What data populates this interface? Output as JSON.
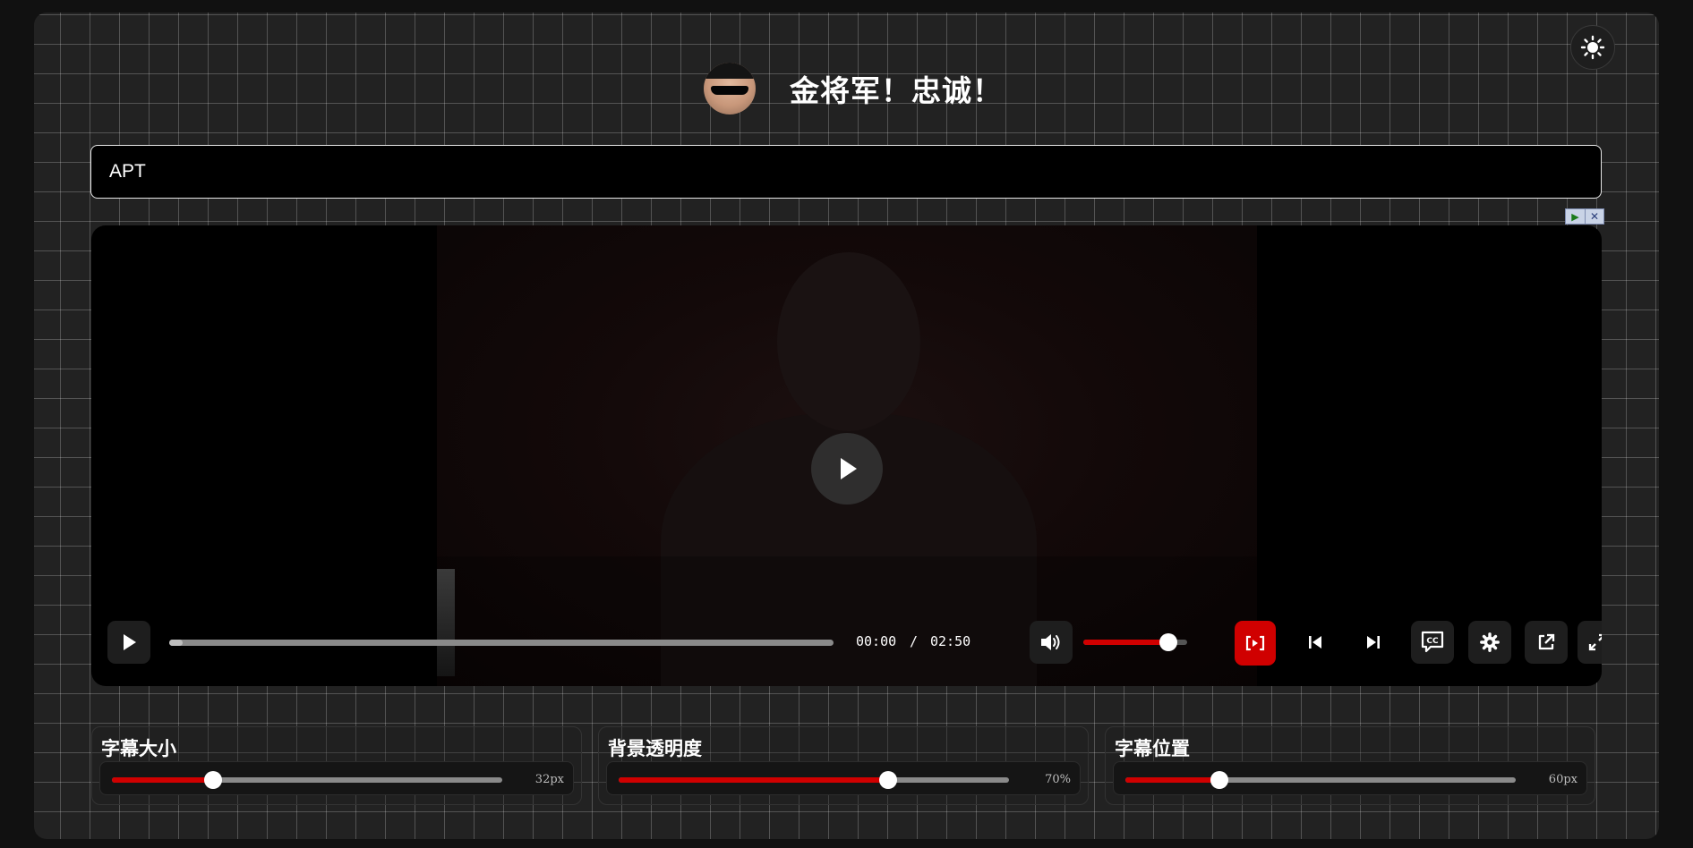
{
  "header": {
    "title": "金将军！忠诚！"
  },
  "search": {
    "value": "APT"
  },
  "player": {
    "time_current": "00:00",
    "time_separator": "/",
    "time_total": "02:50",
    "progress": 0.02,
    "volume": 0.82
  },
  "panels": [
    {
      "label": "字幕大小",
      "value_text": "32px",
      "level": 0.26
    },
    {
      "label": "背景透明度",
      "value_text": "70%",
      "level": 0.69
    },
    {
      "label": "字幕位置",
      "value_text": "60px",
      "level": 0.24
    }
  ],
  "colors": {
    "accent": "#d00000",
    "background": "#222222",
    "grid": "#555555"
  },
  "icons": [
    "sun-icon",
    "play-icon",
    "volume-icon",
    "subtitle-toggle-icon",
    "skip-previous-icon",
    "skip-next-icon",
    "cc-icon",
    "gear-icon",
    "external-link-icon",
    "fullscreen-icon"
  ]
}
